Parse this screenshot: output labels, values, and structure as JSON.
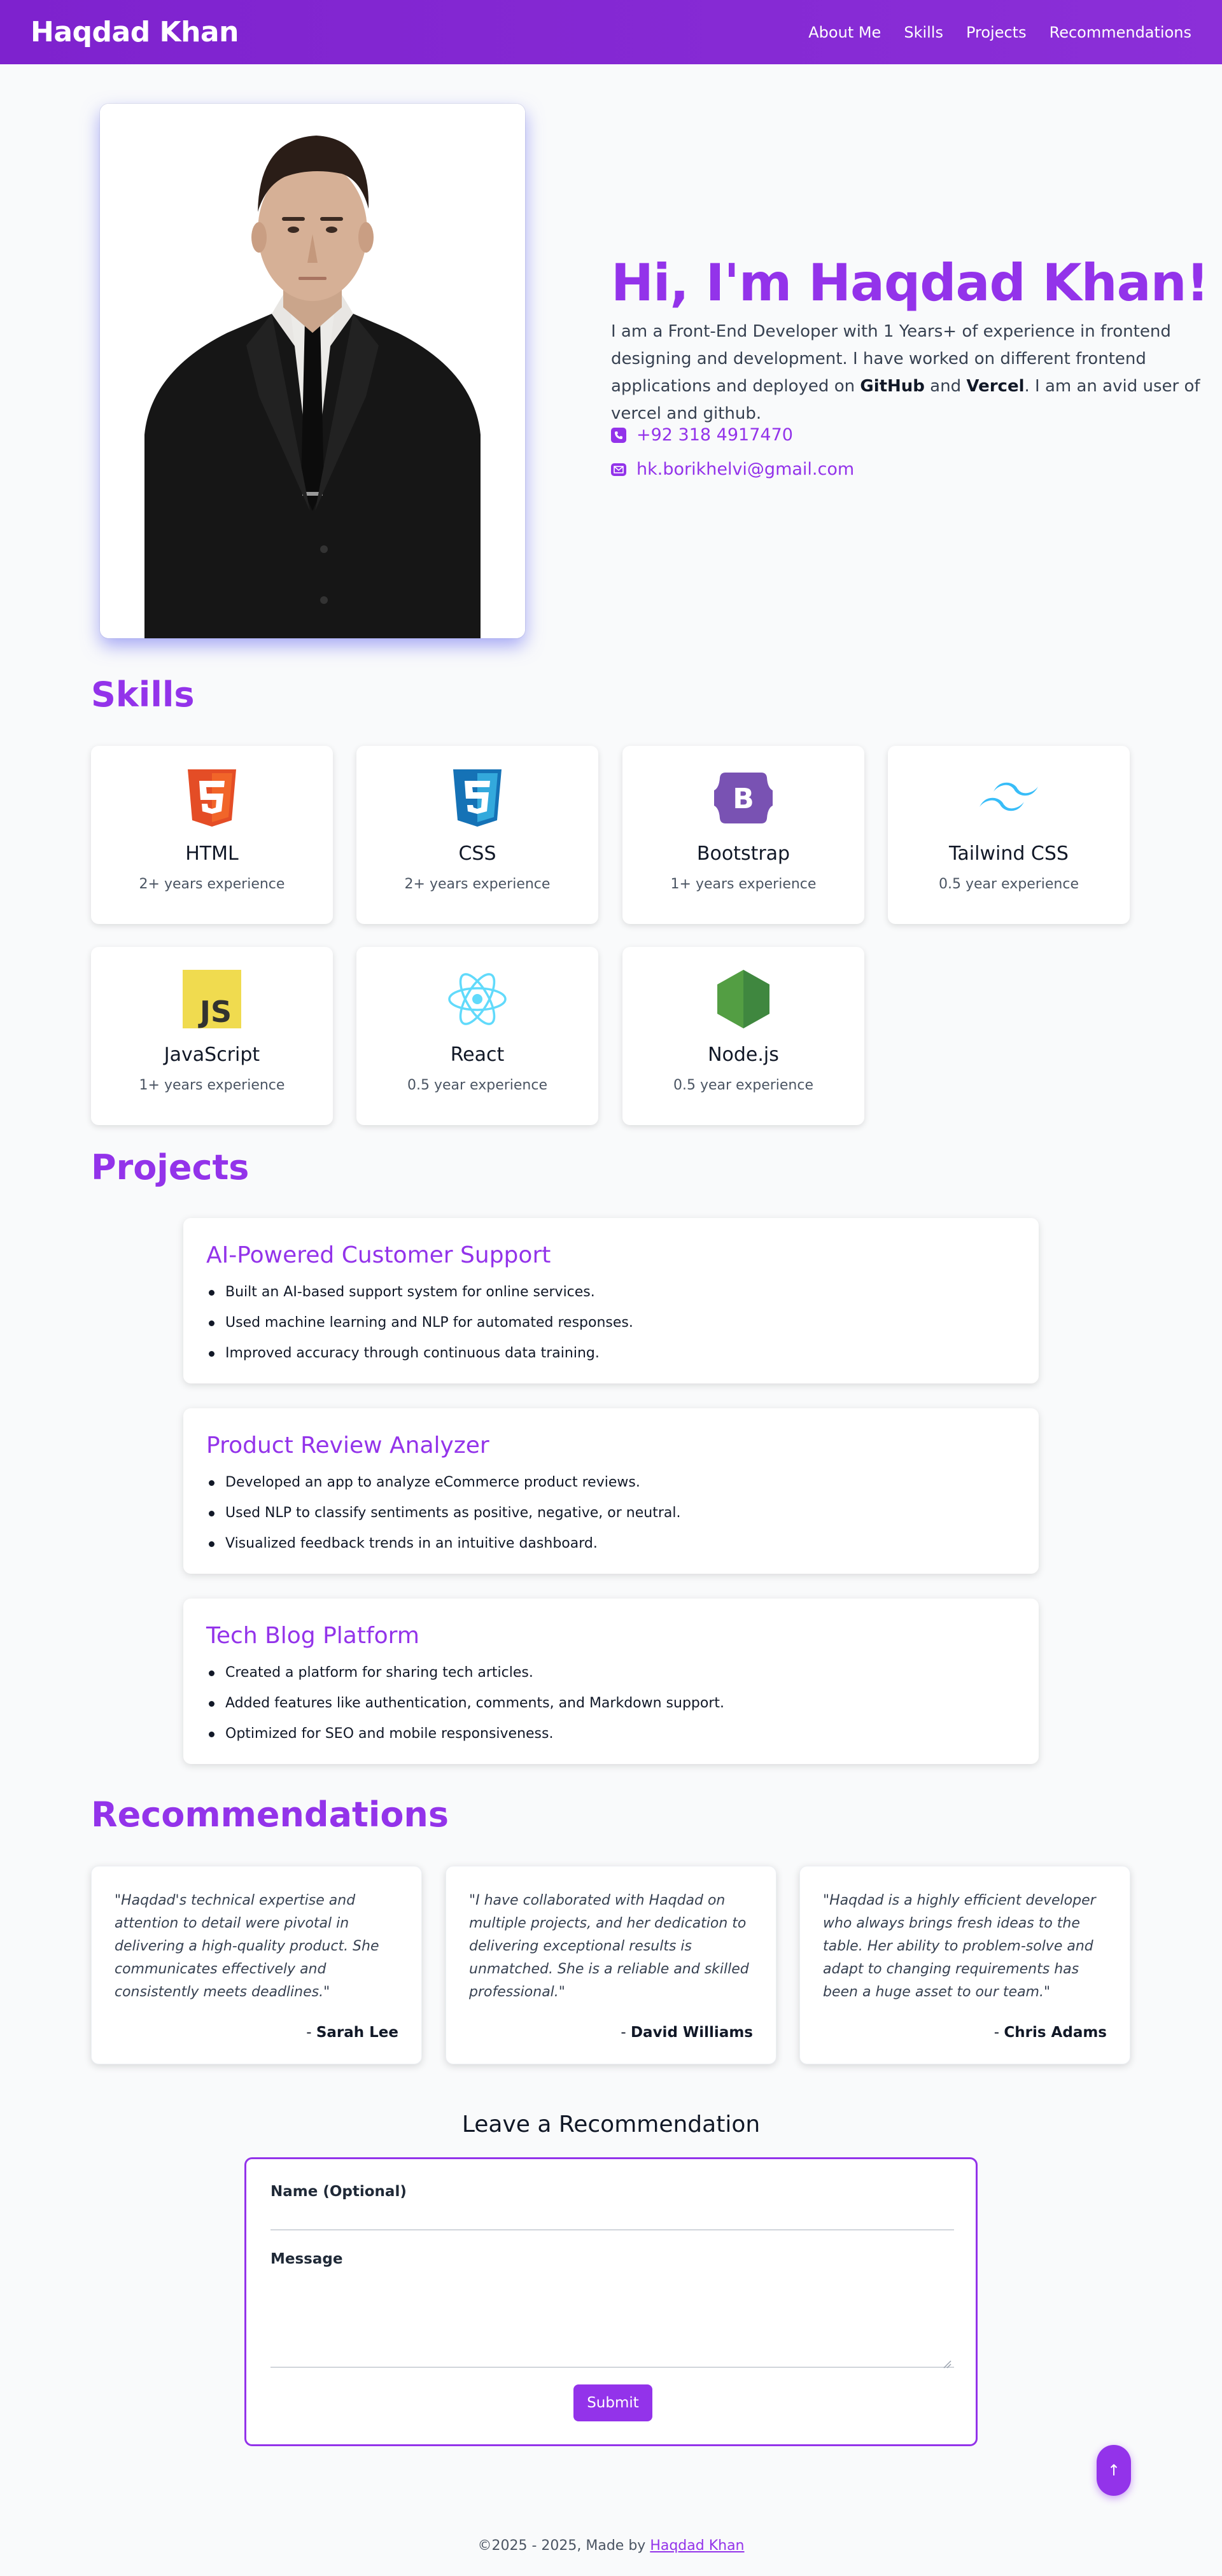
{
  "nav": {
    "brand": "Haqdad Khan",
    "links": [
      "About Me",
      "Skills",
      "Projects",
      "Recommendations"
    ]
  },
  "hero": {
    "greeting": "Hi, I'm Haqdad Khan!",
    "wave_icon": "waving-hand-emoji",
    "desc_part1": "I am a Front-End Developer with 1 Years+ of experience in frontend designing and development. I have worked on different frontend applications and deployed on ",
    "desc_github": "GitHub",
    "desc_and": " and ",
    "desc_vercel": "Vercel",
    "desc_part2": ". I am an avid user of vercel and github.",
    "phone": "+92 318 4917470",
    "email": "hk.borikhelvi@gmail.com"
  },
  "skills": {
    "title": "Skills",
    "items": [
      {
        "name": "HTML",
        "exp": "2+ years experience",
        "icon": "html5-icon"
      },
      {
        "name": "CSS",
        "exp": "2+ years experience",
        "icon": "css3-icon"
      },
      {
        "name": "Bootstrap",
        "exp": "1+ years experience",
        "icon": "bootstrap-icon"
      },
      {
        "name": "Tailwind CSS",
        "exp": "0.5 year experience",
        "icon": "tailwind-icon"
      },
      {
        "name": "JavaScript",
        "exp": "1+ years experience",
        "icon": "javascript-icon"
      },
      {
        "name": "React",
        "exp": "0.5 year experience",
        "icon": "react-icon"
      },
      {
        "name": "Node.js",
        "exp": "0.5 year experience",
        "icon": "nodejs-icon"
      }
    ]
  },
  "projects": {
    "title": "Projects",
    "items": [
      {
        "title": "AI-Powered Customer Support",
        "bullets": [
          "Built an AI-based support system for online services.",
          "Used machine learning and NLP for automated responses.",
          "Improved accuracy through continuous data training."
        ]
      },
      {
        "title": "Product Review Analyzer",
        "bullets": [
          "Developed an app to analyze eCommerce product reviews.",
          "Used NLP to classify sentiments as positive, negative, or neutral.",
          "Visualized feedback trends in an intuitive dashboard."
        ]
      },
      {
        "title": "Tech Blog Platform",
        "bullets": [
          "Created a platform for sharing tech articles.",
          "Added features like authentication, comments, and Markdown support.",
          "Optimized for SEO and mobile responsiveness."
        ]
      }
    ]
  },
  "recommendations": {
    "title": "Recommendations",
    "items": [
      {
        "quote": "\"Haqdad's technical expertise and attention to detail were pivotal in delivering a high-quality product. She communicates effectively and consistently meets deadlines.\"",
        "dash": "- ",
        "author": "Sarah Lee"
      },
      {
        "quote": "\"I have collaborated with Haqdad on multiple projects, and her dedication to delivering exceptional results is unmatched. She is a reliable and skilled professional.\"",
        "dash": "- ",
        "author": "David Williams"
      },
      {
        "quote": "\"Haqdad is a highly efficient developer who always brings fresh ideas to the table. Her ability to problem-solve and adapt to changing requirements has been a huge asset to our team.\"",
        "dash": "- ",
        "author": "Chris Adams"
      }
    ]
  },
  "form": {
    "title": "Leave a Recommendation",
    "name_label": "Name (Optional)",
    "name_value": "",
    "message_label": "Message",
    "message_value": "",
    "submit_label": "Submit"
  },
  "scroll_top": {
    "label": "↑"
  },
  "footer": {
    "text": "©2025 - 2025, Made by ",
    "link": "Haqdad Khan"
  },
  "colors": {
    "accent": "#9333ea",
    "nav": "#7e22ce",
    "background": "#f9fafb"
  }
}
